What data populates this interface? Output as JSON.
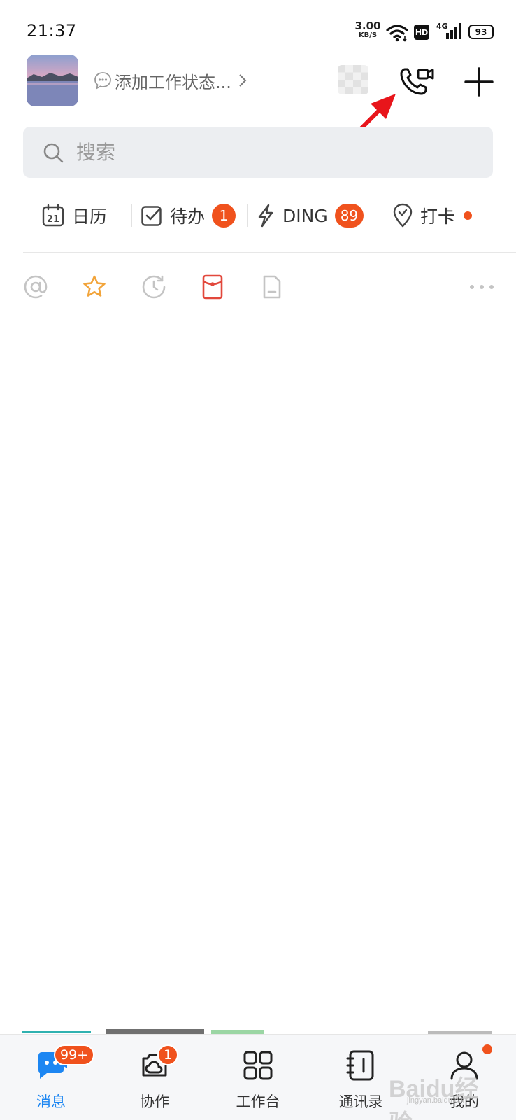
{
  "status_bar": {
    "time": "21:37",
    "net_speed_value": "3.00",
    "net_speed_unit": "KB/S",
    "hd_label": "HD",
    "network_label": "4G",
    "battery": "93"
  },
  "header": {
    "status_label": "添加工作状态...",
    "icons": [
      "avatar",
      "status-bubble-icon",
      "chevron-right-icon",
      "sticker-placeholder",
      "video-call-icon",
      "add-icon"
    ]
  },
  "search": {
    "placeholder": "搜索"
  },
  "quick_bar": {
    "items": [
      {
        "label": "日历",
        "icon": "calendar-icon",
        "calendar_day": "21"
      },
      {
        "label": "待办",
        "icon": "todo-check-icon",
        "badge": "1"
      },
      {
        "label": "DING",
        "icon": "lightning-icon",
        "badge": "89"
      },
      {
        "label": "打卡",
        "icon": "location-check-icon",
        "dot": true
      }
    ]
  },
  "filter_row": {
    "icons": [
      "at-mention-icon",
      "star-icon",
      "recent-clock-icon",
      "red-packet-icon",
      "document-icon",
      "more-dots-icon"
    ]
  },
  "tabbar": {
    "tabs": [
      {
        "label": "消息",
        "icon": "message-icon",
        "badge": "99+",
        "active": true
      },
      {
        "label": "协作",
        "icon": "collaboration-icon",
        "badge": "1"
      },
      {
        "label": "工作台",
        "icon": "workbench-grid-icon"
      },
      {
        "label": "通讯录",
        "icon": "contacts-book-icon"
      },
      {
        "label": "我的",
        "icon": "profile-icon",
        "dot": true
      }
    ]
  },
  "watermark": {
    "brand": "Baidu经验",
    "url": "jingyan.baidu.com"
  },
  "colors": {
    "accent": "#1c86f2",
    "badge": "#f0521d",
    "arrow": "#e8151b",
    "star": "#f2a43a",
    "red_packet": "#e2483c"
  }
}
